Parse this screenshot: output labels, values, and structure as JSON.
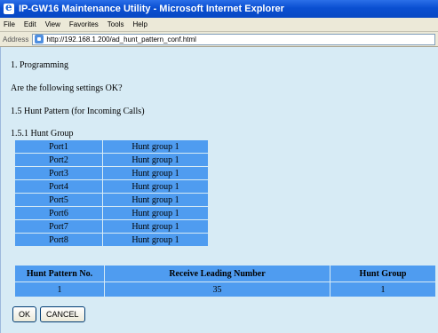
{
  "window": {
    "title": "IP-GW16 Maintenance Utility - Microsoft Internet Explorer"
  },
  "menu": [
    "File",
    "Edit",
    "View",
    "Favorites",
    "Tools",
    "Help"
  ],
  "address": {
    "label": "Address",
    "url": "http://192.168.1.200/ad_hunt_pattern_conf.html"
  },
  "page": {
    "heading1": "1. Programming",
    "question": "Are the following settings OK?",
    "section": "1.5 Hunt Pattern (for Incoming Calls)",
    "subsection": "1.5.1 Hunt Group",
    "ports": [
      {
        "port": "Port1",
        "group": "Hunt group 1"
      },
      {
        "port": "Port2",
        "group": "Hunt group 1"
      },
      {
        "port": "Port3",
        "group": "Hunt group 1"
      },
      {
        "port": "Port4",
        "group": "Hunt group 1"
      },
      {
        "port": "Port5",
        "group": "Hunt group 1"
      },
      {
        "port": "Port6",
        "group": "Hunt group 1"
      },
      {
        "port": "Port7",
        "group": "Hunt group 1"
      },
      {
        "port": "Port8",
        "group": "Hunt group 1"
      }
    ],
    "pattern_table": {
      "headers": [
        "Hunt Pattern No.",
        "Receive Leading Number",
        "Hunt Group"
      ],
      "row": [
        "1",
        "35",
        "1"
      ]
    },
    "buttons": {
      "ok": "OK",
      "cancel": "CANCEL"
    }
  }
}
